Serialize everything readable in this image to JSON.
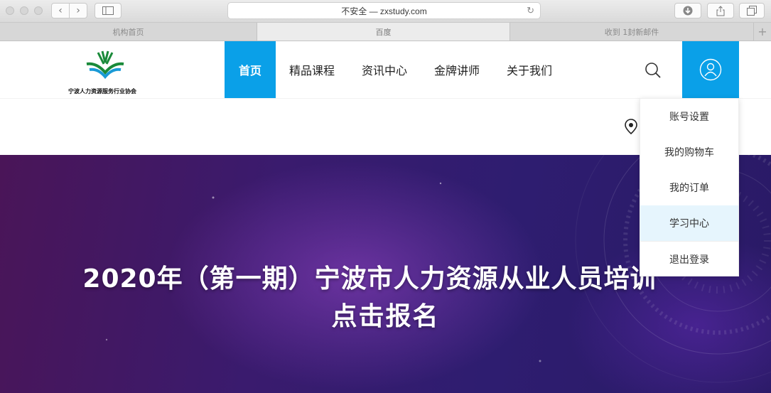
{
  "browser": {
    "address": "不安全 — zxstudy.com",
    "tabs": [
      {
        "label": "机构首页",
        "active": false
      },
      {
        "label": "百度",
        "active": true
      },
      {
        "label": "收到 1封新邮件",
        "active": false
      }
    ]
  },
  "header": {
    "logo_text": "宁波人力资源服务行业协会",
    "nav": [
      {
        "label": "首页",
        "active": true
      },
      {
        "label": "精品课程",
        "active": false
      },
      {
        "label": "资讯中心",
        "active": false
      },
      {
        "label": "金牌讲师",
        "active": false
      },
      {
        "label": "关于我们",
        "active": false
      }
    ],
    "search_icon": "search-icon",
    "user_icon": "user-icon"
  },
  "user_menu": {
    "items": [
      {
        "label": "账号设置",
        "hover": false
      },
      {
        "label": "我的购物车",
        "hover": false
      },
      {
        "label": "我的订单",
        "hover": false
      },
      {
        "label": "学习中心",
        "hover": true
      },
      {
        "label": "退出登录",
        "hover": false
      }
    ]
  },
  "hero": {
    "title": "2020年（第一期）宁波市人力资源从业人员培训",
    "cta": "点击报名"
  },
  "colors": {
    "accent": "#0aa0e8",
    "menu_hover": "#e6f5fd"
  }
}
